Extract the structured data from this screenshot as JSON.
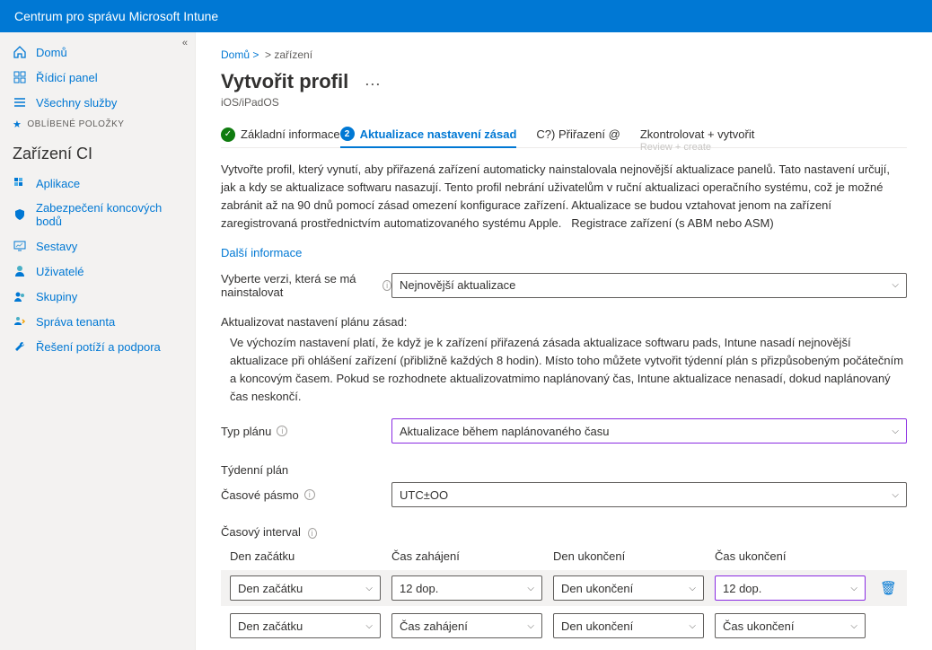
{
  "topbar": {
    "title": "Centrum pro správu Microsoft Intune"
  },
  "sidebar": {
    "collapse_glyph": "«",
    "items_top": [
      {
        "label": "Domů",
        "icon": "home"
      },
      {
        "label": "Řídicí panel",
        "icon": "dashboard"
      },
      {
        "label": "Všechny služby",
        "icon": "list"
      }
    ],
    "favorites_label": "OBLÍBENÉ POLOŽKY",
    "group_title": "Zařízení CI",
    "items_group": [
      {
        "label": "Aplikace",
        "icon": "apps"
      },
      {
        "label": "Zabezpečení koncových bodů",
        "icon": "shield"
      },
      {
        "label": "Sestavy",
        "icon": "monitor"
      },
      {
        "label": "Uživatelé",
        "icon": "user"
      },
      {
        "label": "Skupiny",
        "icon": "group"
      },
      {
        "label": "Správa tenanta",
        "icon": "tenant"
      },
      {
        "label": "Řešení potíží a podpora",
        "icon": "wrench"
      }
    ]
  },
  "breadcrumb": {
    "part1": "Domů &gt;",
    "part2": "&gt; zařízení"
  },
  "page": {
    "title": "Vytvořit profil",
    "subtitle": "iOS/iPadOS"
  },
  "tabs": {
    "t1": "Základní informace",
    "t2": "Aktualizace nastavení zásad",
    "t3": "C?) Přiřazení @",
    "t4": "Zkontrolovat + vytvořit",
    "t4_ghost": "Review + create"
  },
  "desc1": "Vytvořte profil, který vynutí, aby přiřazená zařízení automaticky nainstalovala nejnovější aktualizace panelů. Tato nastavení určují, jak a kdy se aktualizace softwaru nasazují. Tento profil nebrání uživatelům v ruční aktualizaci operačního systému, což je možné zabránit až na 90 dnů pomocí zásad omezení konfigurace zařízení. Aktualizace se budou vztahovat jenom na zařízení zaregistrovaná prostřednictvím automatizovaného systému Apple.",
  "desc1_tail": "Registrace zařízení (s ABM nebo ASM)",
  "more_info": "Další informace",
  "form": {
    "version_label": "Vyberte verzi, která se má nainstalovat",
    "version_info": "i",
    "version_value": "Nejnovější aktualizace",
    "policy_heading": "Aktualizovat nastavení plánu zásad:",
    "policy_para": "Ve výchozím nastavení platí, že když je k zařízení přiřazená zásada aktualizace softwaru pads, Intune nasadí nejnovější aktualizace při ohlášení zařízení (přibližně každých 8 hodin). Místo toho můžete vytvořit týdenní plán s přizpůsobeným počátečním a koncovým časem. Pokud se rozhodnete aktualizovatmimo naplánovaný čas, Intune aktualizace nenasadí, dokud naplánovaný čas neskončí.",
    "plan_type_label": "Typ plánu",
    "plan_type_value": "Aktualizace během naplánovaného času",
    "weekly_label": "Týdenní plán",
    "tz_label": "Časové pásmo",
    "tz_value": "UTC±OO",
    "interval_label": "Časový interval",
    "col1": "Den začátku",
    "col2": "Čas zahájení",
    "col3": "Den ukončení",
    "col4": "Čas ukončení",
    "row1": {
      "c1": "Den začátku",
      "c2": "12 dop.",
      "c3": "Den ukončení",
      "c4": "12 dop."
    },
    "row2": {
      "c1": "Den začátku",
      "c2": "Čas zahájení",
      "c3": "Den ukončení",
      "c4": "Čas ukončení"
    }
  }
}
